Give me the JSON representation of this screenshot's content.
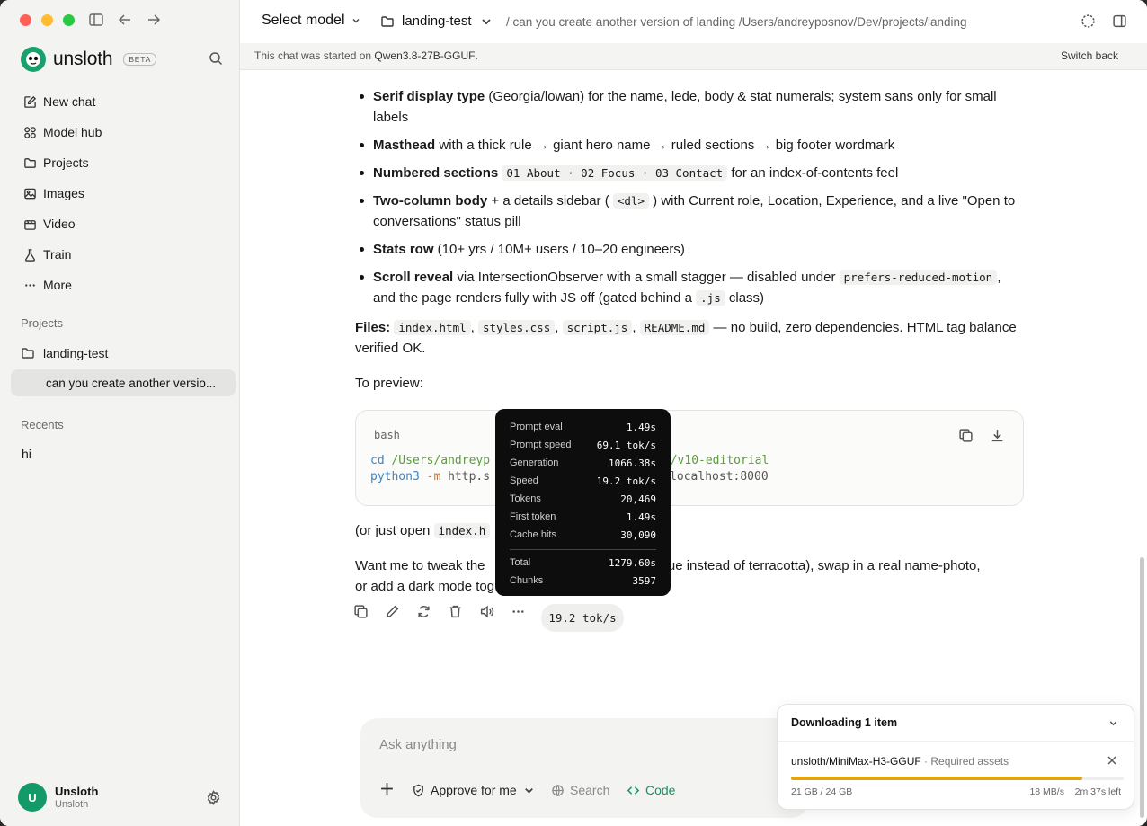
{
  "sidebar": {
    "brand": "unsloth",
    "beta": "BETA",
    "nav": [
      {
        "label": "New chat",
        "icon": "edit-icon"
      },
      {
        "label": "Model hub",
        "icon": "grid-icon"
      },
      {
        "label": "Projects",
        "icon": "folder-icon"
      },
      {
        "label": "Images",
        "icon": "image-icon"
      },
      {
        "label": "Video",
        "icon": "video-icon"
      },
      {
        "label": "Train",
        "icon": "flask-icon"
      },
      {
        "label": "More",
        "icon": "more-icon"
      }
    ],
    "projects_label": "Projects",
    "project": "landing-test",
    "active_chat": "can you create another versio...",
    "recents_label": "Recents",
    "recents": [
      "hi"
    ],
    "user": {
      "initial": "U",
      "name": "Unsloth",
      "sub": "Unsloth"
    }
  },
  "topbar": {
    "model": "Select model",
    "project": "landing-test",
    "path": "/ can you create another version of landing /Users/andreyposnov/Dev/projects/landing"
  },
  "notice": {
    "prefix": "This chat was started on ",
    "model": "Qwen3.8-27B-GGUF",
    "suffix": ".",
    "action": "Switch back"
  },
  "message": {
    "bullets": [
      {
        "bold": "Serif display type",
        "rest": " (Georgia/lowan) for the name, lede, body & stat numerals; system sans only for small labels"
      },
      {
        "bold": "Masthead",
        "rest": " with a thick rule → giant hero name → ruled sections → big footer wordmark"
      },
      {
        "bold": "Numbered sections",
        "code": "01 About · 02 Focus · 03 Contact",
        "rest": " for an index-of-contents feel"
      },
      {
        "bold": "Two-column body",
        "pre": " + a details sidebar ( ",
        "code": "<dl>",
        "rest": " ) with Current role, Location, Experience, and a live \"Open to conversations\" status pill"
      },
      {
        "bold": "Stats row",
        "rest": " (10+ yrs / 10M+ users / 10–20 engineers)"
      },
      {
        "bold": "Scroll reveal",
        "pre": " via IntersectionObserver with a small stagger — disabled under ",
        "code": "prefers-reduced-motion",
        "mid": ", and the page renders fully with JS off (gated behind a ",
        "code2": ".js",
        "rest": " class)"
      }
    ],
    "files_label": "Files:",
    "files": [
      "index.html",
      "styles.css",
      "script.js",
      "README.md"
    ],
    "files_rest": " — no build, zero dependencies. HTML tag balance verified OK.",
    "preview": "To preview:",
    "code_lang": "bash",
    "code_line1_cmd": "cd",
    "code_line1_path": " /Users/andreyp",
    "code_line1_tail": "ng/v10-editorial",
    "code_line2_cmd": "python3",
    "code_line2_flag": " -m",
    "code_line2_mod": " http.s",
    "code_line2_tail": "localhost:8000",
    "after_pre": "(or just open ",
    "after_code": "index.h",
    "final_a": "Want me to tweak the",
    "final_b": "lue instead of terracotta), swap in a real name-photo,",
    "final_c": "or add a dark mode tog"
  },
  "stats": {
    "rows": [
      {
        "k": "Prompt eval",
        "v": "1.49s"
      },
      {
        "k": "Prompt speed",
        "v": "69.1 tok/s"
      },
      {
        "k": "Generation",
        "v": "1066.38s"
      },
      {
        "k": "Speed",
        "v": "19.2 tok/s"
      },
      {
        "k": "Tokens",
        "v": "20,469"
      },
      {
        "k": "First token",
        "v": "1.49s"
      },
      {
        "k": "Cache hits",
        "v": "30,090"
      }
    ],
    "totals": [
      {
        "k": "Total",
        "v": "1279.60s"
      },
      {
        "k": "Chunks",
        "v": "3597"
      }
    ],
    "pill": "19.2 tok/s"
  },
  "composer": {
    "placeholder": "Ask anything",
    "approve": "Approve for me",
    "search": "Search",
    "code": "Code"
  },
  "download": {
    "title": "Downloading 1 item",
    "name": "unsloth/MiniMax-H3-GGUF",
    "sub": " · Required assets",
    "size": "21 GB / 24 GB",
    "progress": 0.875,
    "rate": "18 MB/s",
    "eta": "2m 37s left",
    "bar_color": "#e2a512"
  }
}
